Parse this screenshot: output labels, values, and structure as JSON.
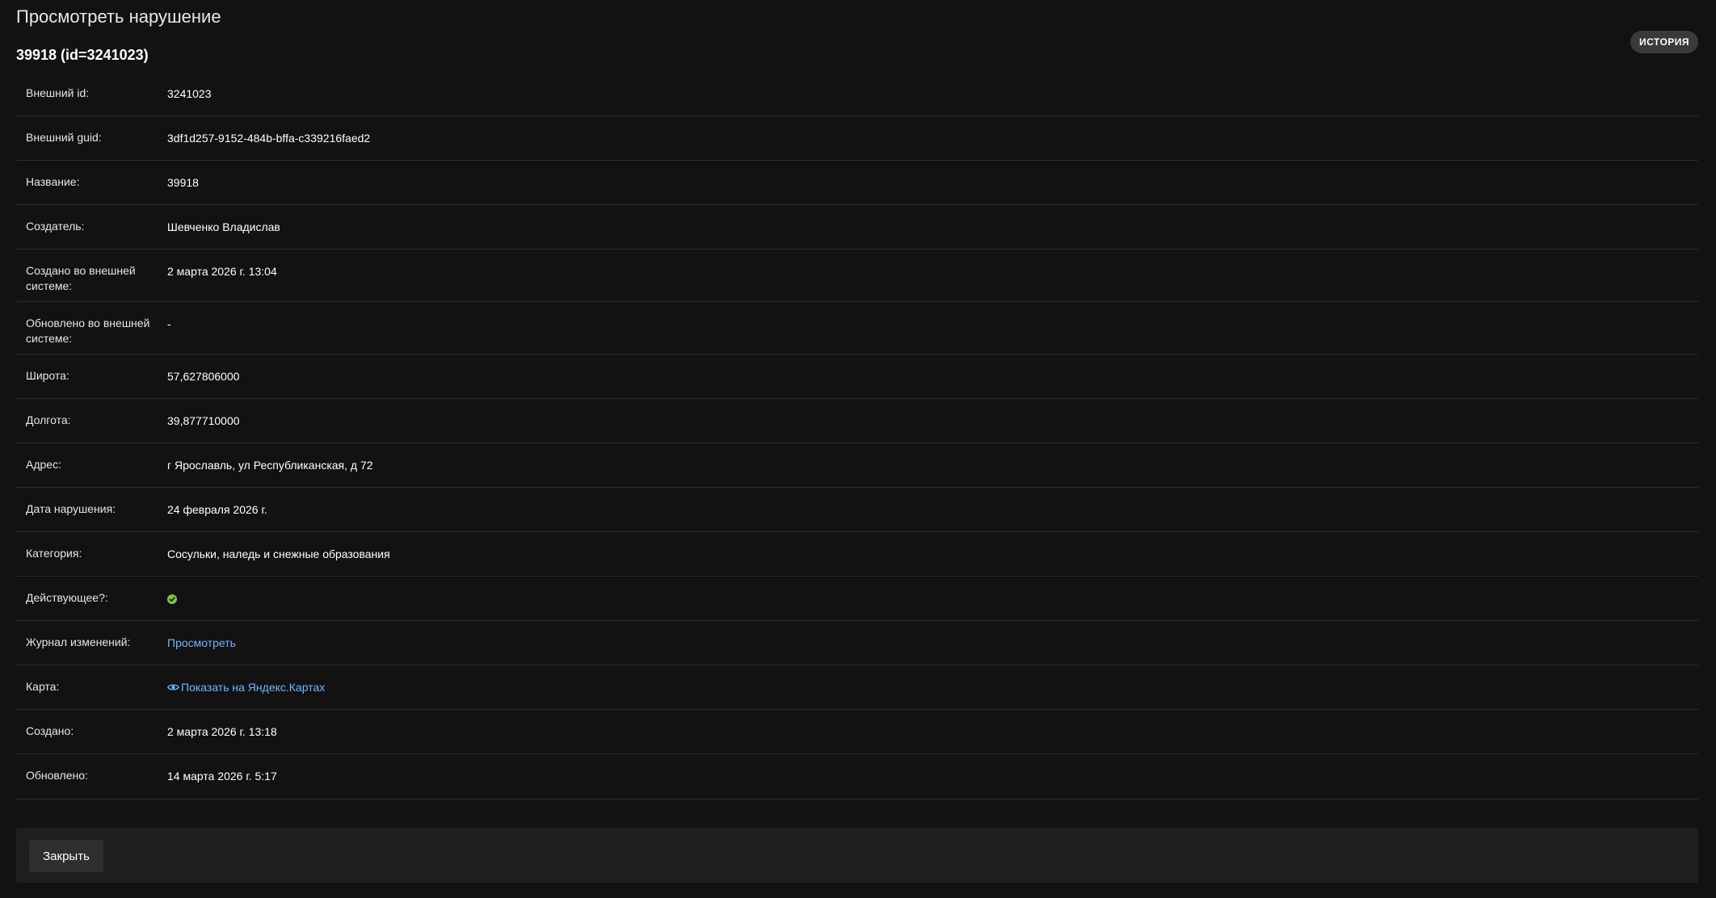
{
  "header": {
    "page_title": "Просмотреть нарушение",
    "object_title": "39918 (id=3241023)",
    "history_button": "ИСТОРИЯ"
  },
  "fields": [
    {
      "label": "Внешний id:",
      "value": "3241023"
    },
    {
      "label": "Внешний guid:",
      "value": "3df1d257-9152-484b-bffa-c339216faed2"
    },
    {
      "label": "Название:",
      "value": "39918"
    },
    {
      "label": "Создатель:",
      "value": "Шевченко Владислав"
    },
    {
      "label": "Создано во внешней системе:",
      "value": "2 марта 2026 г. 13:04"
    },
    {
      "label": "Обновлено во внешней системе:",
      "value": "-"
    },
    {
      "label": "Широта:",
      "value": "57,627806000"
    },
    {
      "label": "Долгота:",
      "value": "39,877710000"
    },
    {
      "label": "Адрес:",
      "value": "г Ярославль, ул Республиканская, д 72"
    },
    {
      "label": "Дата нарушения:",
      "value": "24 февраля 2026 г."
    },
    {
      "label": "Категория:",
      "value": "Сосульки, наледь и снежные образования"
    },
    {
      "label": "Действующее?:",
      "value_icon": "check-circle-icon",
      "value_color": "#7ec142"
    },
    {
      "label": "Журнал изменений:",
      "link": "Просмотреть"
    },
    {
      "label": "Карта:",
      "link": "Показать на Яндекс.Картах",
      "link_icon": "eye-icon"
    },
    {
      "label": "Создано:",
      "value": "2 марта 2026 г. 13:18"
    },
    {
      "label": "Обновлено:",
      "value": "14 марта 2026 г. 5:17"
    }
  ],
  "footer": {
    "close_button": "Закрыть"
  },
  "colors": {
    "background": "#121212",
    "link": "#6fb7ff",
    "success": "#7ec142"
  }
}
